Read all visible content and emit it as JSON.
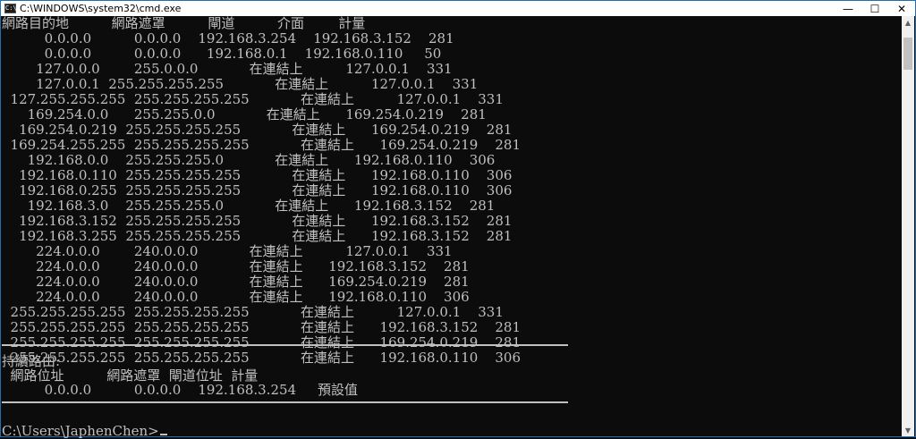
{
  "window": {
    "title": "C:\\WINDOWS\\system32\\cmd.exe",
    "icon_text": "C:\\",
    "minimize": "—",
    "maximize": "☐",
    "close": "✕"
  },
  "lines": [
    "網路目的地          網路遮罩          閘道          介面        計量",
    "          0.0.0.0          0.0.0.0    192.168.3.254    192.168.3.152    281",
    "          0.0.0.0          0.0.0.0      192.168.0.1    192.168.0.110     50",
    "        127.0.0.0        255.0.0.0            在連結上          127.0.0.1    331",
    "        127.0.0.1  255.255.255.255            在連結上          127.0.0.1    331",
    "  127.255.255.255  255.255.255.255            在連結上          127.0.0.1    331",
    "      169.254.0.0      255.255.0.0            在連結上      169.254.0.219    281",
    "    169.254.0.219  255.255.255.255            在連結上      169.254.0.219    281",
    "  169.254.255.255  255.255.255.255            在連結上      169.254.0.219    281",
    "      192.168.0.0    255.255.255.0            在連結上      192.168.0.110    306",
    "    192.168.0.110  255.255.255.255            在連結上      192.168.0.110    306",
    "    192.168.0.255  255.255.255.255            在連結上      192.168.0.110    306",
    "      192.168.3.0    255.255.255.0            在連結上      192.168.3.152    281",
    "    192.168.3.152  255.255.255.255            在連結上      192.168.3.152    281",
    "    192.168.3.255  255.255.255.255            在連結上      192.168.3.152    281",
    "        224.0.0.0        240.0.0.0            在連結上          127.0.0.1    331",
    "        224.0.0.0        240.0.0.0            在連結上      192.168.3.152    281",
    "        224.0.0.0        240.0.0.0            在連結上      169.254.0.219    281",
    "        224.0.0.0        240.0.0.0            在連結上      192.168.0.110    306",
    "  255.255.255.255  255.255.255.255            在連結上          127.0.0.1    331",
    "  255.255.255.255  255.255.255.255            在連結上      192.168.3.152    281",
    "  255.255.255.255  255.255.255.255            在連結上      169.254.0.219    281",
    "  255.255.255.255  255.255.255.255            在連結上      192.168.0.110    306"
  ],
  "persistent": {
    "heading": "持續路由:",
    "header": "  網路位址          網路遮罩  閘道位址  計量",
    "row": "          0.0.0.0          0.0.0.0    192.168.3.254     預設值"
  },
  "prompt": "C:\\Users\\JaphenChen>",
  "colors": {
    "background": "#0c0c0c",
    "text": "#c0c0c0",
    "border": "#1f6fb2"
  }
}
